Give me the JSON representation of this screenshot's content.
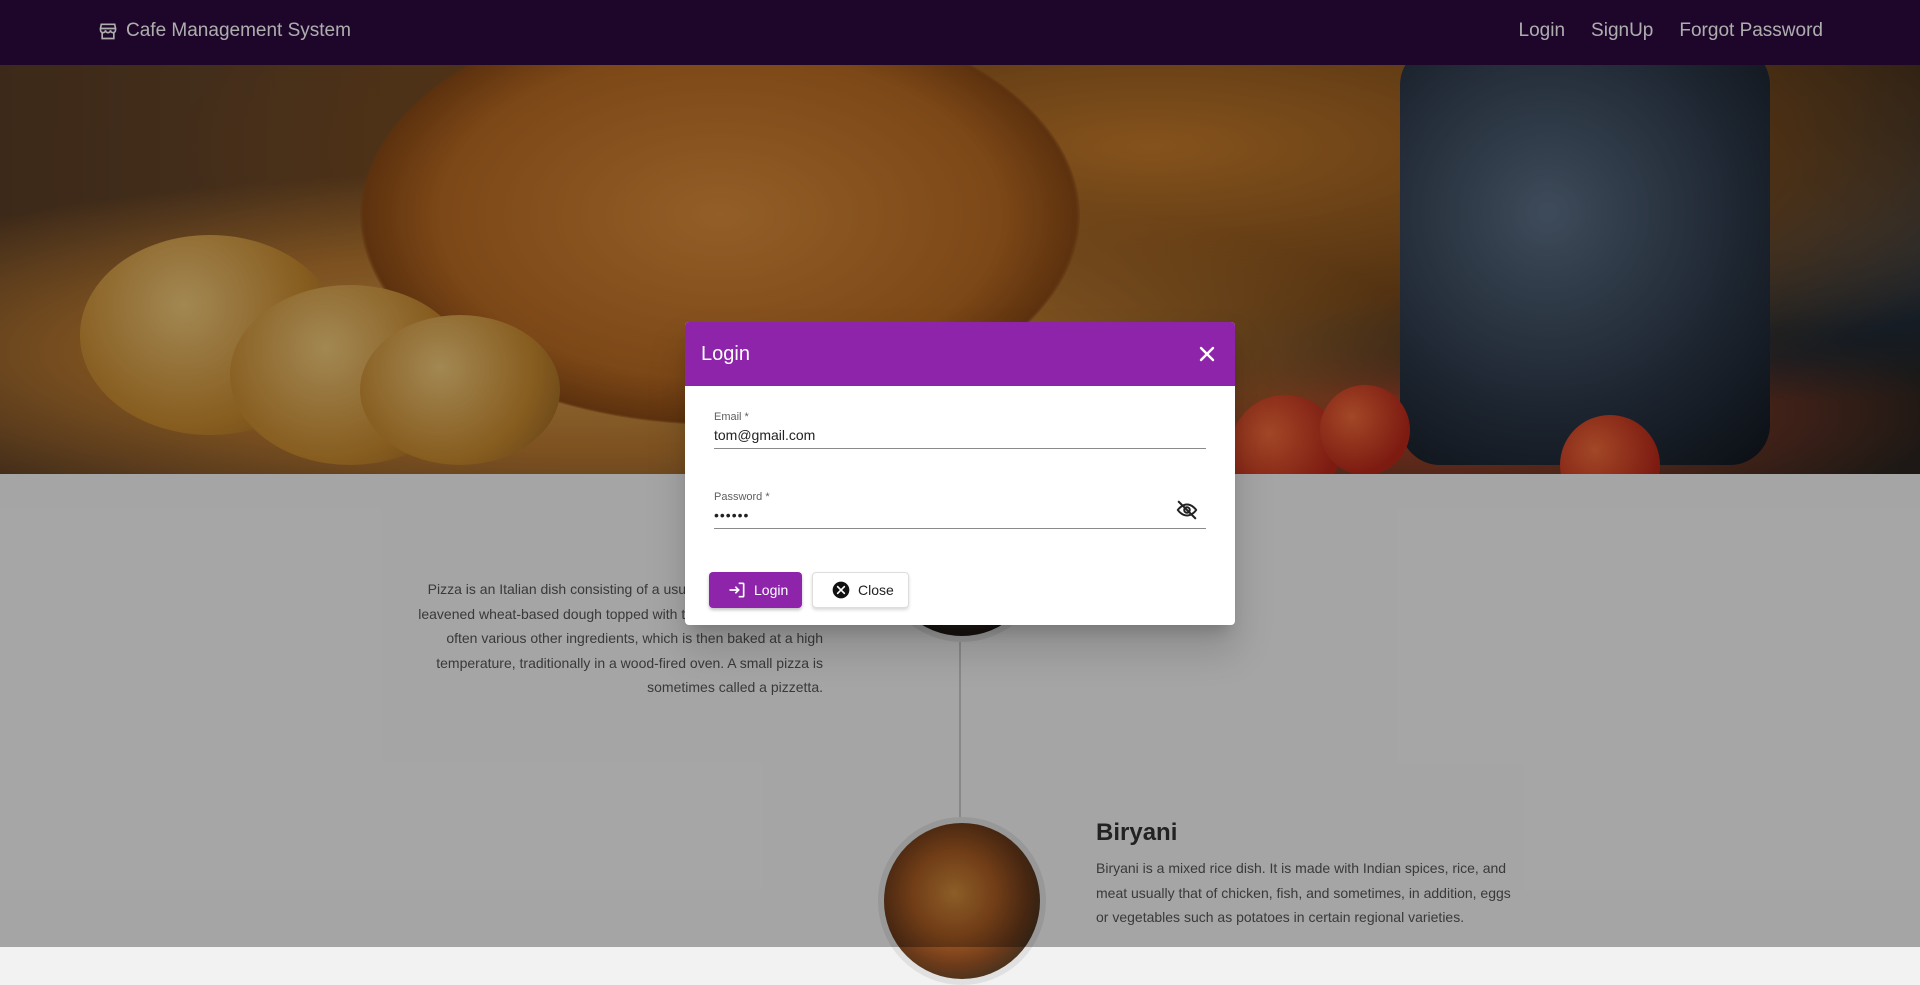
{
  "navbar": {
    "brand": "Cafe Management System",
    "links": [
      "Login",
      "SignUp",
      "Forgot Password"
    ]
  },
  "timeline": {
    "items": [
      {
        "title": "",
        "description": "Pizza is an Italian dish consisting of a usually round, flat base of leavened wheat-based dough topped with tomatoes, cheese, and often various other ingredients, which is then baked at a high temperature, traditionally in a wood-fired oven. A small pizza is sometimes called a pizzetta."
      },
      {
        "title": "Biryani",
        "description": "Biryani is a mixed rice dish. It is made with Indian spices, rice, and meat usually that of chicken, fish, and sometimes, in addition, eggs or vegetables such as potatoes in certain regional varieties."
      }
    ]
  },
  "dialog": {
    "title": "Login",
    "email": {
      "label": "Email *",
      "value": "tom@gmail.com"
    },
    "password": {
      "label": "Password *",
      "value": "••••••"
    },
    "login_button": "Login",
    "close_button": "Close"
  },
  "colors": {
    "accent": "#8e24aa",
    "navbar": "#2d0a40"
  }
}
